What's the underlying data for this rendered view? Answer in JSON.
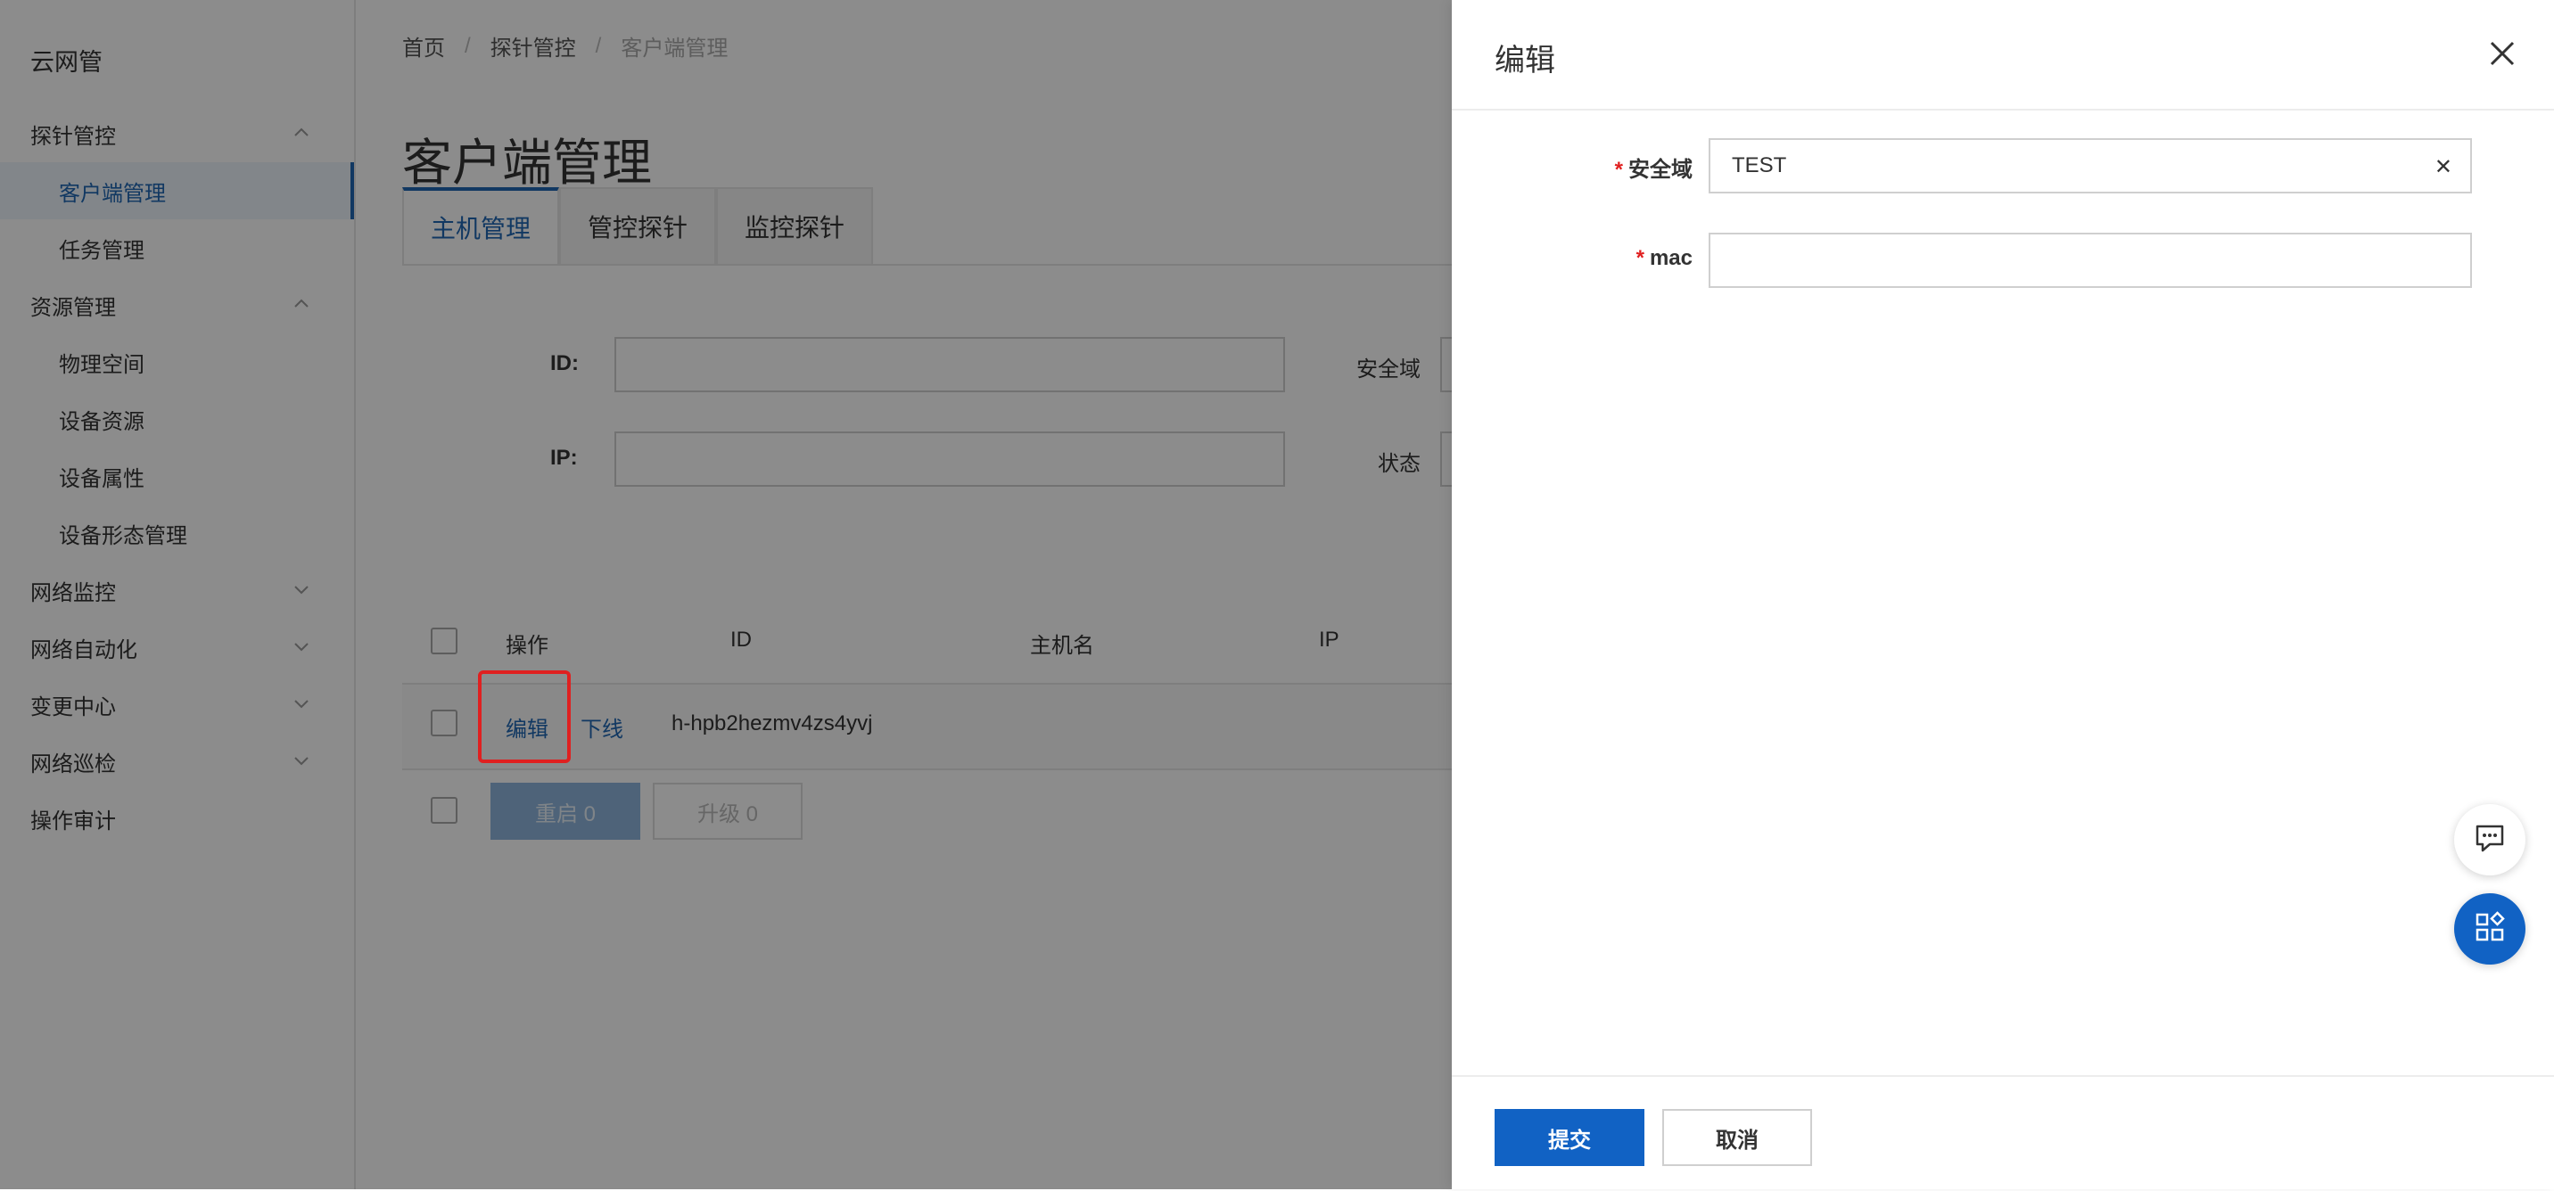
{
  "sidebar": {
    "brand": "云网管",
    "items": [
      {
        "label": "探针管控",
        "kind": "group",
        "expanded": true
      },
      {
        "label": "客户端管理",
        "kind": "sub",
        "active": true
      },
      {
        "label": "任务管理",
        "kind": "sub"
      },
      {
        "label": "资源管理",
        "kind": "group",
        "expanded": true
      },
      {
        "label": "物理空间",
        "kind": "sub"
      },
      {
        "label": "设备资源",
        "kind": "sub"
      },
      {
        "label": "设备属性",
        "kind": "sub"
      },
      {
        "label": "设备形态管理",
        "kind": "sub"
      },
      {
        "label": "网络监控",
        "kind": "group",
        "expanded": false
      },
      {
        "label": "网络自动化",
        "kind": "group",
        "expanded": false
      },
      {
        "label": "变更中心",
        "kind": "group",
        "expanded": false
      },
      {
        "label": "网络巡检",
        "kind": "group",
        "expanded": false
      },
      {
        "label": "操作审计",
        "kind": "group"
      }
    ]
  },
  "breadcrumb": [
    "首页",
    "探针管控",
    "客户端管理"
  ],
  "page": {
    "title": "客户端管理",
    "tabs": [
      "主机管理",
      "管控探针",
      "监控探针"
    ]
  },
  "filters": {
    "id_label": "ID:",
    "ip_label": "IP:",
    "domain_label": "安全域",
    "status_label": "状态"
  },
  "table": {
    "headers": [
      "操作",
      "ID",
      "主机名",
      "IP"
    ],
    "rows": [
      {
        "edit": "编辑",
        "offline": "下线",
        "id": "h-hpb2hezmv4zs4yvj"
      }
    ],
    "bulk_restart": "重启 0",
    "bulk_upgrade": "升级 0"
  },
  "drawer": {
    "title": "编辑",
    "fields": {
      "domain": {
        "label": "安全域",
        "value": "TEST",
        "required": "*"
      },
      "mac": {
        "label": "mac",
        "value": "",
        "required": "*"
      }
    },
    "submit": "提交",
    "cancel": "取消"
  },
  "colors": {
    "primary": "#1162c4",
    "active_text": "#1f67b3",
    "required": "#e02020",
    "highlight": "#e02020"
  }
}
